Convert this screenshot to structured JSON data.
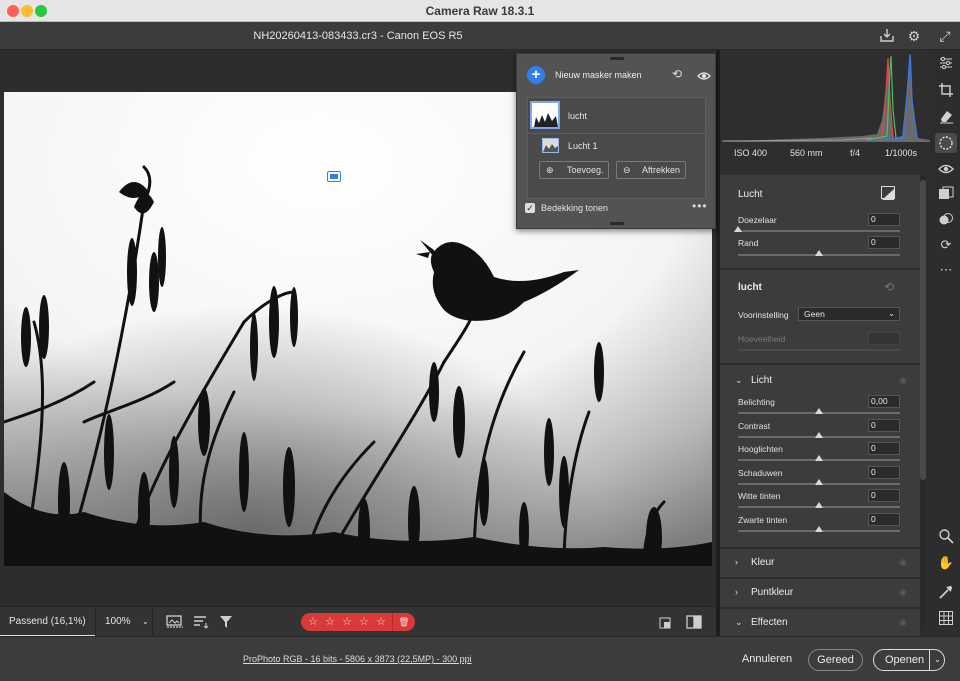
{
  "window": {
    "title": "Camera Raw 18.3.1"
  },
  "header": {
    "file_title": "NH20260413-083433.cr3  -  Canon EOS R5"
  },
  "masks_panel": {
    "new_mask_label": "Nieuw masker maken",
    "mask_name": "lucht",
    "component_name": "Lucht 1",
    "add_button": "Toevoeg.",
    "subtract_button": "Aftrekken",
    "show_overlay_label": "Bedekking tonen",
    "show_overlay_checked": true
  },
  "toolbar": {
    "fit_label": "Passend (16,1%)",
    "zoom_label": "100%",
    "rating": 0
  },
  "camera_info": {
    "iso": "ISO 400",
    "focal": "560 mm",
    "aperture": "f/4",
    "shutter": "1/1000s"
  },
  "mask_section": {
    "title": "Lucht",
    "feather_label": "Doezelaar",
    "feather_value": "0",
    "edge_label": "Rand",
    "edge_value": "0"
  },
  "adjust_section": {
    "title": "lucht",
    "preset_label": "Voorinstelling",
    "preset_value": "Geen",
    "amount_label": "Hoeveelheid"
  },
  "light_section": {
    "title": "Licht",
    "sliders": [
      {
        "label": "Belichting",
        "value": "0,00"
      },
      {
        "label": "Contrast",
        "value": "0"
      },
      {
        "label": "Hooglichten",
        "value": "0"
      },
      {
        "label": "Schaduwen",
        "value": "0"
      },
      {
        "label": "Witte tinten",
        "value": "0"
      },
      {
        "label": "Zwarte tinten",
        "value": "0"
      }
    ]
  },
  "collapsed_sections": [
    "Kleur",
    "Puntkleur",
    "Effecten"
  ],
  "footer": {
    "info": "ProPhoto RGB - 16 bits - 5806 x 3873 (22,5MP) - 300 ppi",
    "cancel": "Annuleren",
    "done": "Gereed",
    "open": "Openen"
  },
  "colors": {
    "accent": "#2f80ed",
    "rating_bg": "#d83a3a"
  }
}
